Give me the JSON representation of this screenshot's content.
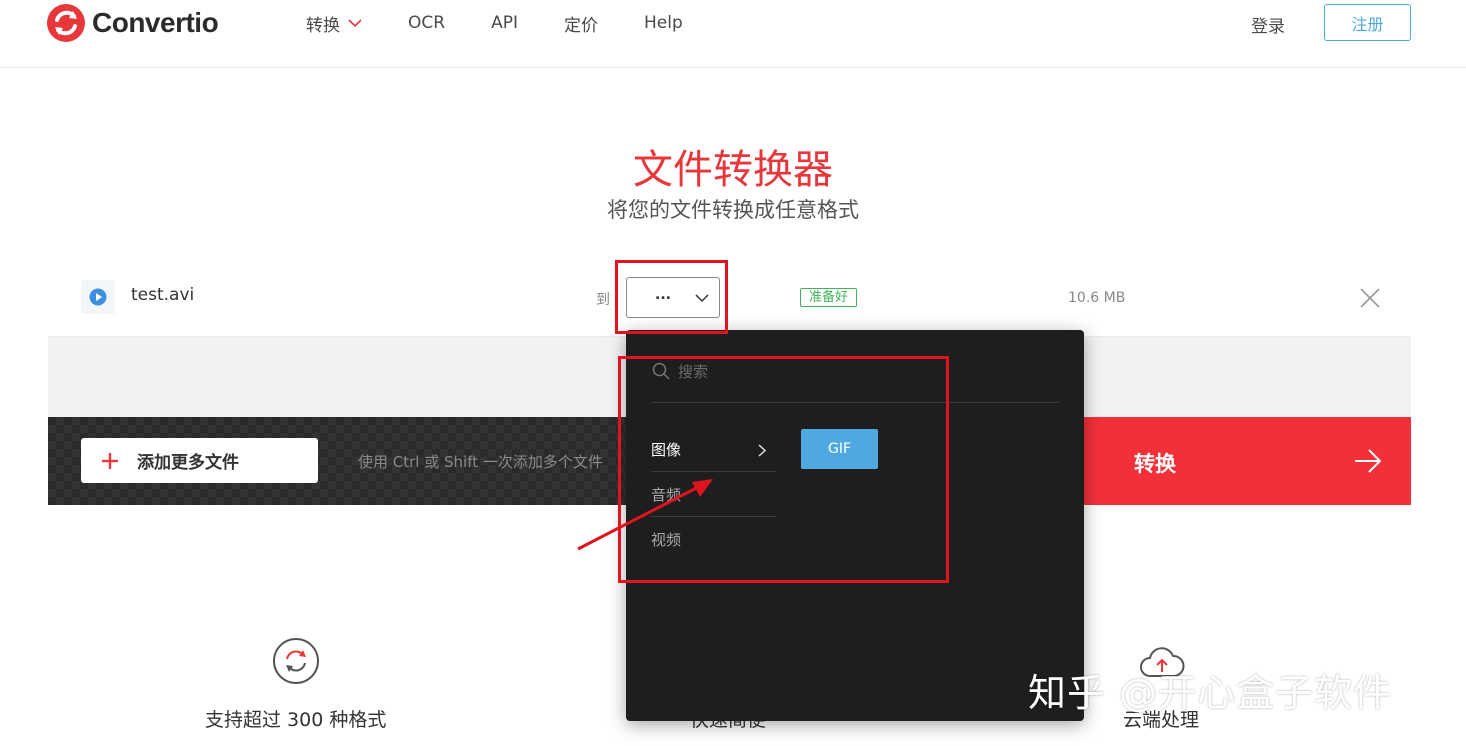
{
  "header": {
    "logo_text": "Convertio",
    "nav": [
      {
        "label": "转换",
        "has_dropdown": true
      },
      {
        "label": "OCR"
      },
      {
        "label": "API"
      },
      {
        "label": "定价"
      },
      {
        "label": "Help"
      }
    ],
    "login_label": "登录",
    "signup_label": "注册"
  },
  "hero": {
    "title": "文件转换器",
    "subtitle": "将您的文件转换成任意格式"
  },
  "file_row": {
    "file_name": "test.avi",
    "file_icon": "play-circle-icon",
    "to_label": "到",
    "format_value": "...",
    "status": "准备好",
    "size": "10.6 MB"
  },
  "actions": {
    "add_files_label": "添加更多文件",
    "hint": "使用 Ctrl 或 Shift 一次添加多个文件",
    "convert_label": "转换"
  },
  "dropdown": {
    "search_placeholder": "搜索",
    "categories": [
      {
        "label": "图像",
        "active": true
      },
      {
        "label": "音频",
        "active": false
      },
      {
        "label": "视频",
        "active": false
      }
    ],
    "formats": [
      "GIF"
    ]
  },
  "features": [
    {
      "label": "支持超过 300 种格式",
      "icon": "refresh-cycle-icon"
    },
    {
      "label": "快速简便",
      "icon": "speed-icon"
    },
    {
      "label": "云端处理",
      "icon": "cloud-upload-icon"
    }
  ],
  "watermark": "知乎 @开心盒子软件",
  "colors": {
    "brand_red": "#e8373b",
    "convert_red": "#f2303a",
    "accent_blue": "#4fa9e0",
    "ready_green": "#41b35a",
    "dropdown_bg": "#1e1e1e",
    "annotation_red": "#e0141e"
  }
}
